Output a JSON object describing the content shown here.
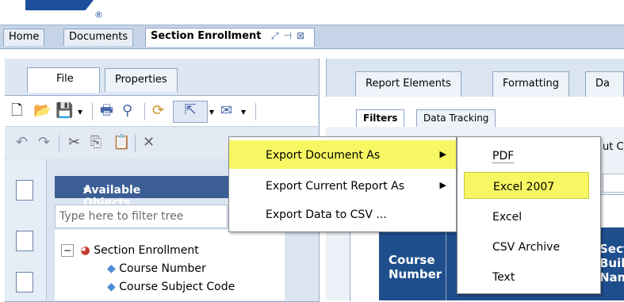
{
  "doc_tabs": [
    {
      "label": "Home"
    },
    {
      "label": "Documents"
    },
    {
      "label": "Section Enrollment"
    }
  ],
  "left_panel": {
    "tabs": [
      {
        "label": "File"
      },
      {
        "label": "Properties"
      }
    ],
    "available_objects": {
      "title": "Available Objects",
      "filter_placeholder": "Type here to filter tree",
      "tree": [
        {
          "label": "Section Enrollment"
        },
        {
          "label": "Course Number"
        },
        {
          "label": "Course Subject Code"
        }
      ]
    }
  },
  "right_panel": {
    "tabs": [
      {
        "label": "Report Elements"
      },
      {
        "label": "Formatting"
      },
      {
        "label": "Da"
      }
    ],
    "subtabs": [
      {
        "label": "Filters"
      },
      {
        "label": "Data Tracking"
      }
    ],
    "partial_text": "ut C",
    "grid_header": {
      "col1": [
        "Course",
        "Number"
      ],
      "col2": [
        "Sect",
        "Buil",
        "Nam"
      ]
    }
  },
  "export_menu": {
    "items": [
      {
        "label": "Export Document As",
        "highlighted": true,
        "has_submenu": true
      },
      {
        "label": "Export Current Report As",
        "has_submenu": true
      },
      {
        "label": "Export Data to CSV ..."
      }
    ]
  },
  "export_submenu": {
    "items": [
      {
        "label": "PDF"
      },
      {
        "label": "Excel 2007",
        "highlighted": true
      },
      {
        "label": "Excel"
      },
      {
        "label": "CSV Archive"
      },
      {
        "label": "Text"
      }
    ]
  },
  "colors": {
    "menu_highlight": "#f7f763",
    "header_blue": "#1f4e8c",
    "panel_blue": "#3b5f95"
  }
}
